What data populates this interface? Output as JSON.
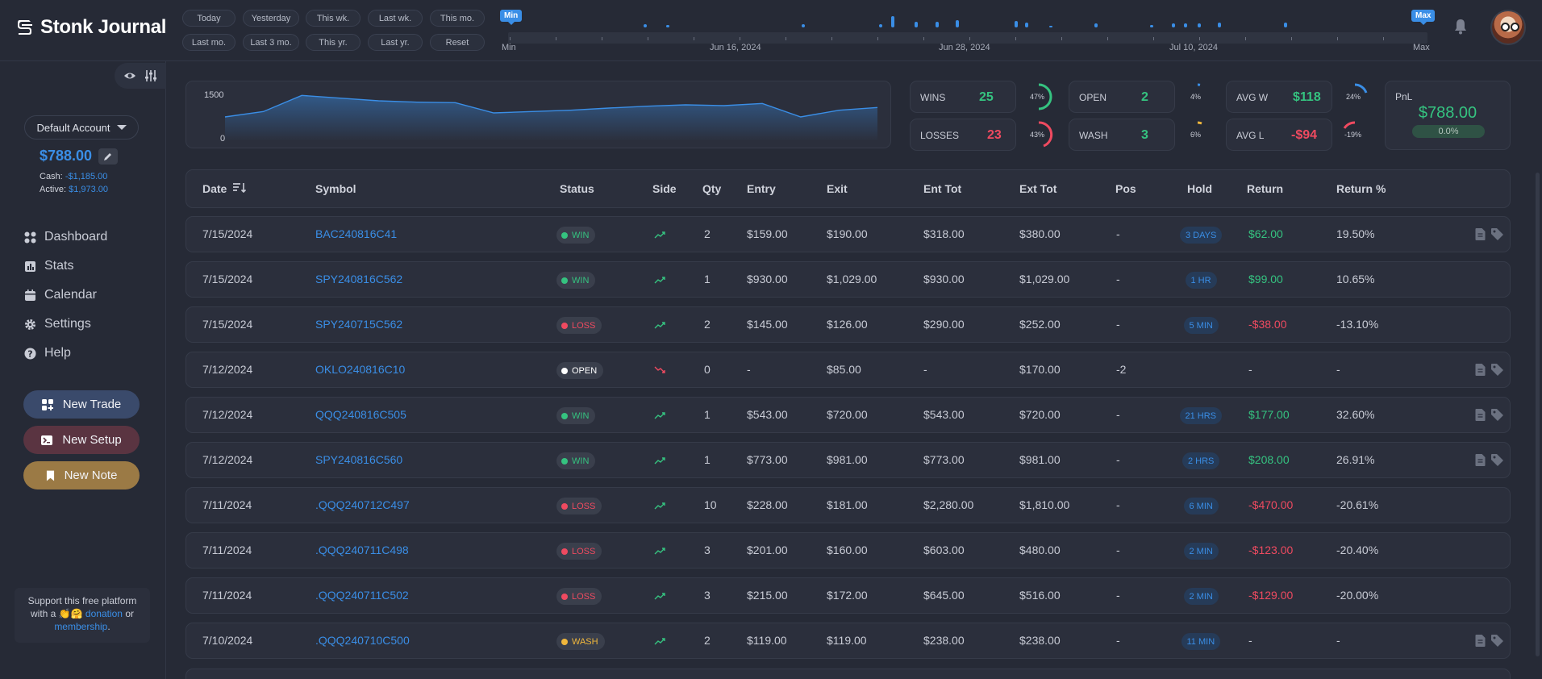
{
  "app": {
    "name": "Stonk Journal"
  },
  "date_filters": {
    "row1": [
      "Today",
      "Yesterday",
      "This wk.",
      "Last wk.",
      "This mo."
    ],
    "row2": [
      "Last mo.",
      "Last 3 mo.",
      "This yr.",
      "Last yr.",
      "Reset"
    ]
  },
  "timeline": {
    "min_flag": "Min",
    "max_flag": "Max",
    "labels": [
      "Min",
      "Jun 16, 2024",
      "Jun 28, 2024",
      "Jul 10, 2024",
      "Max"
    ]
  },
  "sidebar": {
    "account_label": "Default Account",
    "balance": "$788.00",
    "cash_label": "Cash:",
    "cash_value": "-$1,185.00",
    "active_label": "Active:",
    "active_value": "$1,973.00",
    "nav": [
      {
        "label": "Dashboard",
        "icon": "dashboard-icon"
      },
      {
        "label": "Stats",
        "icon": "stats-icon"
      },
      {
        "label": "Calendar",
        "icon": "calendar-icon"
      },
      {
        "label": "Settings",
        "icon": "gear-icon"
      },
      {
        "label": "Help",
        "icon": "help-icon"
      }
    ],
    "buttons": {
      "new_trade": "New Trade",
      "new_setup": "New Setup",
      "new_note": "New Note"
    },
    "support": {
      "line1": "Support this free platform",
      "line2a": "with a 👏🤗",
      "donation": "donation",
      "or": "or",
      "membership": "membership",
      "period": "."
    }
  },
  "equity_chart": {
    "ticks": [
      "1500",
      "0"
    ],
    "values": [
      900,
      1100,
      1700,
      1600,
      1500,
      1450,
      1430,
      1050,
      1100,
      1150,
      1230,
      1300,
      1350,
      1320,
      1400,
      900,
      1150,
      1250
    ],
    "ylim": [
      0,
      1800
    ]
  },
  "stats": {
    "wins": {
      "label": "WINS",
      "value": "25",
      "pct": "47%"
    },
    "losses": {
      "label": "LOSSES",
      "value": "23",
      "pct": "43%"
    },
    "open": {
      "label": "OPEN",
      "value": "2",
      "pct": "4%"
    },
    "wash": {
      "label": "WASH",
      "value": "3",
      "pct": "6%"
    },
    "avg_w": {
      "label": "AVG W",
      "value": "$118",
      "pct": "24%"
    },
    "avg_l": {
      "label": "AVG L",
      "value": "-$94",
      "pct": "-19%"
    },
    "pnl": {
      "label": "PnL",
      "value": "$788.00",
      "pct": "0.0%"
    }
  },
  "table": {
    "headers": [
      "Date",
      "Symbol",
      "Status",
      "Side",
      "Qty",
      "Entry",
      "Exit",
      "Ent Tot",
      "Ext Tot",
      "Pos",
      "Hold",
      "Return",
      "Return %"
    ],
    "rows": [
      {
        "date": "7/15/2024",
        "symbol": "BAC240816C41",
        "status": "WIN",
        "side": "up",
        "qty": "2",
        "entry": "$159.00",
        "exit": "$190.00",
        "ent_tot": "$318.00",
        "ext_tot": "$380.00",
        "pos": "-",
        "hold": "3 DAYS",
        "ret": "$62.00",
        "ret_pct": "19.50%",
        "icons": true
      },
      {
        "date": "7/15/2024",
        "symbol": "SPY240816C562",
        "status": "WIN",
        "side": "up",
        "qty": "1",
        "entry": "$930.00",
        "exit": "$1,029.00",
        "ent_tot": "$930.00",
        "ext_tot": "$1,029.00",
        "pos": "-",
        "hold": "1 HR",
        "ret": "$99.00",
        "ret_pct": "10.65%",
        "icons": false
      },
      {
        "date": "7/15/2024",
        "symbol": "SPY240715C562",
        "status": "LOSS",
        "side": "up",
        "qty": "2",
        "entry": "$145.00",
        "exit": "$126.00",
        "ent_tot": "$290.00",
        "ext_tot": "$252.00",
        "pos": "-",
        "hold": "5 MIN",
        "ret": "-$38.00",
        "ret_pct": "-13.10%",
        "icons": false
      },
      {
        "date": "7/12/2024",
        "symbol": "OKLO240816C10",
        "status": "OPEN",
        "side": "down",
        "qty": "0",
        "entry": "-",
        "exit": "$85.00",
        "ent_tot": "-",
        "ext_tot": "$170.00",
        "pos": "-2",
        "hold": "",
        "ret": "-",
        "ret_pct": "-",
        "icons": true
      },
      {
        "date": "7/12/2024",
        "symbol": "QQQ240816C505",
        "status": "WIN",
        "side": "up",
        "qty": "1",
        "entry": "$543.00",
        "exit": "$720.00",
        "ent_tot": "$543.00",
        "ext_tot": "$720.00",
        "pos": "-",
        "hold": "21 HRS",
        "ret": "$177.00",
        "ret_pct": "32.60%",
        "icons": true
      },
      {
        "date": "7/12/2024",
        "symbol": "SPY240816C560",
        "status": "WIN",
        "side": "up",
        "qty": "1",
        "entry": "$773.00",
        "exit": "$981.00",
        "ent_tot": "$773.00",
        "ext_tot": "$981.00",
        "pos": "-",
        "hold": "2 HRS",
        "ret": "$208.00",
        "ret_pct": "26.91%",
        "icons": true
      },
      {
        "date": "7/11/2024",
        "symbol": ".QQQ240712C497",
        "status": "LOSS",
        "side": "up",
        "qty": "10",
        "entry": "$228.00",
        "exit": "$181.00",
        "ent_tot": "$2,280.00",
        "ext_tot": "$1,810.00",
        "pos": "-",
        "hold": "6 MIN",
        "ret": "-$470.00",
        "ret_pct": "-20.61%",
        "icons": false
      },
      {
        "date": "7/11/2024",
        "symbol": ".QQQ240711C498",
        "status": "LOSS",
        "side": "up",
        "qty": "3",
        "entry": "$201.00",
        "exit": "$160.00",
        "ent_tot": "$603.00",
        "ext_tot": "$480.00",
        "pos": "-",
        "hold": "2 MIN",
        "ret": "-$123.00",
        "ret_pct": "-20.40%",
        "icons": false
      },
      {
        "date": "7/11/2024",
        "symbol": ".QQQ240711C502",
        "status": "LOSS",
        "side": "up",
        "qty": "3",
        "entry": "$215.00",
        "exit": "$172.00",
        "ent_tot": "$645.00",
        "ext_tot": "$516.00",
        "pos": "-",
        "hold": "2 MIN",
        "ret": "-$129.00",
        "ret_pct": "-20.00%",
        "icons": false
      },
      {
        "date": "7/10/2024",
        "symbol": ".QQQ240710C500",
        "status": "WASH",
        "side": "up",
        "qty": "2",
        "entry": "$119.00",
        "exit": "$119.00",
        "ent_tot": "$238.00",
        "ext_tot": "$238.00",
        "pos": "-",
        "hold": "11 MIN",
        "ret": "-",
        "ret_pct": "-",
        "icons": true
      }
    ]
  },
  "colors": {
    "accent": "#3a8ee6",
    "win": "#35c380",
    "loss": "#ef4a60",
    "open": "#ffffff",
    "wash": "#f0b73c",
    "new_trade_bg": "#3a4a6b",
    "new_setup_bg": "#5a3441",
    "new_note_bg": "#9b7a45"
  }
}
